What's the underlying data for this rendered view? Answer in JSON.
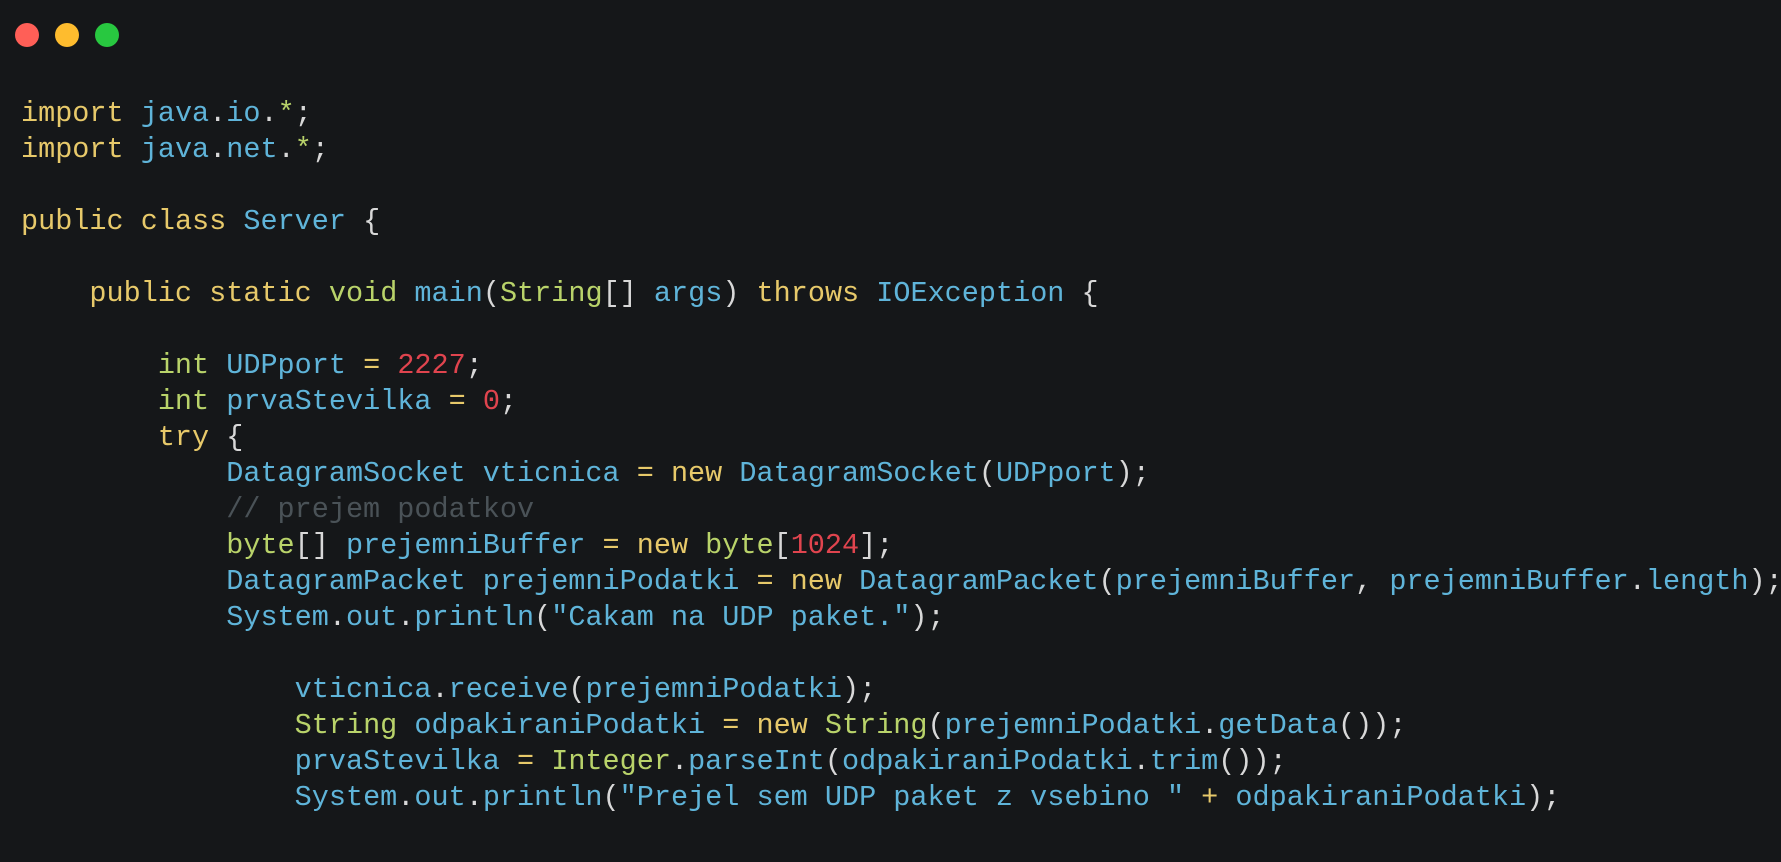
{
  "window": {
    "controls": [
      {
        "name": "close",
        "color": "#ff5f57"
      },
      {
        "name": "minimize",
        "color": "#febc2e"
      },
      {
        "name": "maximize",
        "color": "#28c840"
      }
    ]
  },
  "colors": {
    "background": "#151719",
    "keyword": "#e7c96a",
    "type": "#b9d36a",
    "identifier": "#5fb4d9",
    "number": "#e0444e",
    "comment": "#4a5257",
    "punctuation": "#d8d8d8"
  },
  "code": {
    "lines": [
      [
        [
          "kw",
          "import"
        ],
        [
          "pn",
          " "
        ],
        [
          "id",
          "java"
        ],
        [
          "pn",
          "."
        ],
        [
          "id",
          "io"
        ],
        [
          "pn",
          "."
        ],
        [
          "ty",
          "*"
        ],
        [
          "pn",
          ";"
        ]
      ],
      [
        [
          "kw",
          "import"
        ],
        [
          "pn",
          " "
        ],
        [
          "id",
          "java"
        ],
        [
          "pn",
          "."
        ],
        [
          "id",
          "net"
        ],
        [
          "pn",
          "."
        ],
        [
          "ty",
          "*"
        ],
        [
          "pn",
          ";"
        ]
      ],
      [],
      [
        [
          "kw",
          "public"
        ],
        [
          "pn",
          " "
        ],
        [
          "kw",
          "class"
        ],
        [
          "pn",
          " "
        ],
        [
          "id",
          "Server"
        ],
        [
          "pn",
          " {"
        ]
      ],
      [],
      [
        [
          "pn",
          "    "
        ],
        [
          "kw",
          "public"
        ],
        [
          "pn",
          " "
        ],
        [
          "kw",
          "static"
        ],
        [
          "pn",
          " "
        ],
        [
          "ty",
          "void"
        ],
        [
          "pn",
          " "
        ],
        [
          "id",
          "main"
        ],
        [
          "pn",
          "("
        ],
        [
          "ty",
          "String"
        ],
        [
          "pn",
          "[] "
        ],
        [
          "id",
          "args"
        ],
        [
          "pn",
          ") "
        ],
        [
          "kw",
          "throws"
        ],
        [
          "pn",
          " "
        ],
        [
          "id",
          "IOException"
        ],
        [
          "pn",
          " {"
        ]
      ],
      [],
      [
        [
          "pn",
          "        "
        ],
        [
          "ty",
          "int"
        ],
        [
          "pn",
          " "
        ],
        [
          "id",
          "UDPport"
        ],
        [
          "pn",
          " "
        ],
        [
          "kw",
          "="
        ],
        [
          "pn",
          " "
        ],
        [
          "num",
          "2227"
        ],
        [
          "pn",
          ";"
        ]
      ],
      [
        [
          "pn",
          "        "
        ],
        [
          "ty",
          "int"
        ],
        [
          "pn",
          " "
        ],
        [
          "id",
          "prvaStevilka"
        ],
        [
          "pn",
          " "
        ],
        [
          "kw",
          "="
        ],
        [
          "pn",
          " "
        ],
        [
          "num",
          "0"
        ],
        [
          "pn",
          ";"
        ]
      ],
      [
        [
          "pn",
          "        "
        ],
        [
          "kw",
          "try"
        ],
        [
          "pn",
          " {"
        ]
      ],
      [
        [
          "pn",
          "            "
        ],
        [
          "id",
          "DatagramSocket"
        ],
        [
          "pn",
          " "
        ],
        [
          "id",
          "vticnica"
        ],
        [
          "pn",
          " "
        ],
        [
          "kw",
          "="
        ],
        [
          "pn",
          " "
        ],
        [
          "kw",
          "new"
        ],
        [
          "pn",
          " "
        ],
        [
          "id",
          "DatagramSocket"
        ],
        [
          "pn",
          "("
        ],
        [
          "id",
          "UDPport"
        ],
        [
          "pn",
          ");"
        ]
      ],
      [
        [
          "pn",
          "            "
        ],
        [
          "cm",
          "// prejem podatkov"
        ]
      ],
      [
        [
          "pn",
          "            "
        ],
        [
          "ty",
          "byte"
        ],
        [
          "pn",
          "[] "
        ],
        [
          "id",
          "prejemniBuffer"
        ],
        [
          "pn",
          " "
        ],
        [
          "kw",
          "="
        ],
        [
          "pn",
          " "
        ],
        [
          "kw",
          "new"
        ],
        [
          "pn",
          " "
        ],
        [
          "ty",
          "byte"
        ],
        [
          "pn",
          "["
        ],
        [
          "num",
          "1024"
        ],
        [
          "pn",
          "];"
        ]
      ],
      [
        [
          "pn",
          "            "
        ],
        [
          "id",
          "DatagramPacket"
        ],
        [
          "pn",
          " "
        ],
        [
          "id",
          "prejemniPodatki"
        ],
        [
          "pn",
          " "
        ],
        [
          "kw",
          "="
        ],
        [
          "pn",
          " "
        ],
        [
          "kw",
          "new"
        ],
        [
          "pn",
          " "
        ],
        [
          "id",
          "DatagramPacket"
        ],
        [
          "pn",
          "("
        ],
        [
          "id",
          "prejemniBuffer"
        ],
        [
          "pn",
          ", "
        ],
        [
          "id",
          "prejemniBuffer"
        ],
        [
          "pn",
          "."
        ],
        [
          "id",
          "length"
        ],
        [
          "pn",
          ");"
        ]
      ],
      [
        [
          "pn",
          "            "
        ],
        [
          "id",
          "System"
        ],
        [
          "pn",
          "."
        ],
        [
          "id",
          "out"
        ],
        [
          "pn",
          "."
        ],
        [
          "id",
          "println"
        ],
        [
          "pn",
          "("
        ],
        [
          "str",
          "\"Cakam na UDP paket.\""
        ],
        [
          "pn",
          ");"
        ]
      ],
      [],
      [
        [
          "pn",
          "                "
        ],
        [
          "id",
          "vticnica"
        ],
        [
          "pn",
          "."
        ],
        [
          "id",
          "receive"
        ],
        [
          "pn",
          "("
        ],
        [
          "id",
          "prejemniPodatki"
        ],
        [
          "pn",
          ");"
        ]
      ],
      [
        [
          "pn",
          "                "
        ],
        [
          "ty",
          "String"
        ],
        [
          "pn",
          " "
        ],
        [
          "id",
          "odpakiraniPodatki"
        ],
        [
          "pn",
          " "
        ],
        [
          "kw",
          "="
        ],
        [
          "pn",
          " "
        ],
        [
          "kw",
          "new"
        ],
        [
          "pn",
          " "
        ],
        [
          "ty",
          "String"
        ],
        [
          "pn",
          "("
        ],
        [
          "id",
          "prejemniPodatki"
        ],
        [
          "pn",
          "."
        ],
        [
          "id",
          "getData"
        ],
        [
          "pn",
          "());"
        ]
      ],
      [
        [
          "pn",
          "                "
        ],
        [
          "id",
          "prvaStevilka"
        ],
        [
          "pn",
          " "
        ],
        [
          "kw",
          "="
        ],
        [
          "pn",
          " "
        ],
        [
          "ty",
          "Integer"
        ],
        [
          "pn",
          "."
        ],
        [
          "id",
          "parseInt"
        ],
        [
          "pn",
          "("
        ],
        [
          "id",
          "odpakiraniPodatki"
        ],
        [
          "pn",
          "."
        ],
        [
          "id",
          "trim"
        ],
        [
          "pn",
          "());"
        ]
      ],
      [
        [
          "pn",
          "                "
        ],
        [
          "id",
          "System"
        ],
        [
          "pn",
          "."
        ],
        [
          "id",
          "out"
        ],
        [
          "pn",
          "."
        ],
        [
          "id",
          "println"
        ],
        [
          "pn",
          "("
        ],
        [
          "str",
          "\"Prejel sem UDP paket z vsebino \""
        ],
        [
          "pn",
          " "
        ],
        [
          "kw",
          "+"
        ],
        [
          "pn",
          " "
        ],
        [
          "id",
          "odpakiraniPodatki"
        ],
        [
          "pn",
          ");"
        ]
      ]
    ]
  }
}
